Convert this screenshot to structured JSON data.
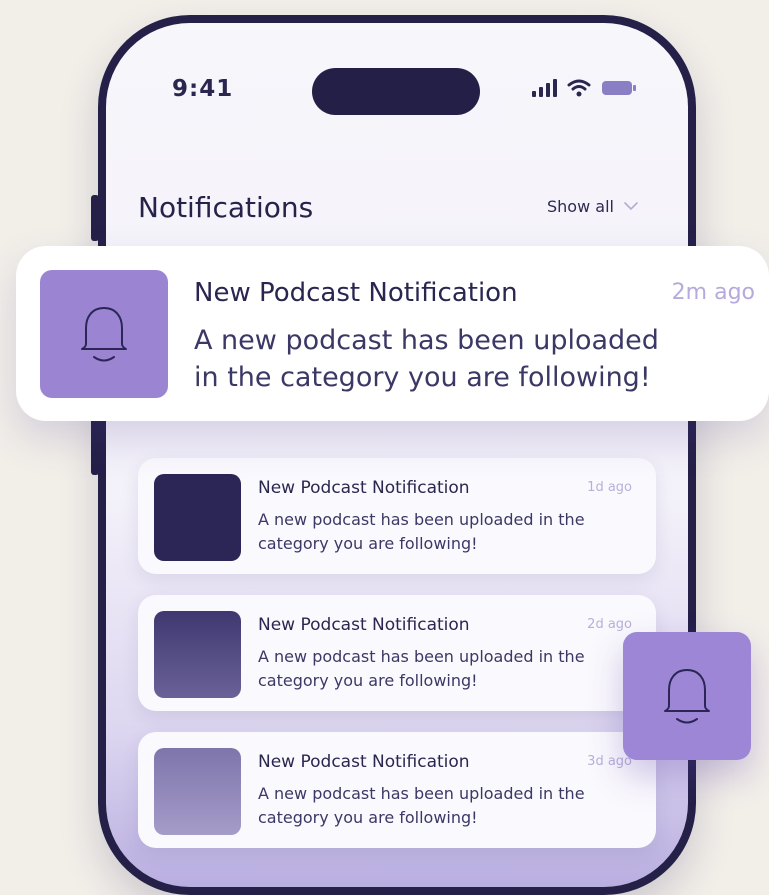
{
  "status": {
    "time": "9:41"
  },
  "header": {
    "title": "Notifications",
    "show_all_label": "Show all"
  },
  "featured": {
    "title": "New Podcast Notification",
    "time": "2m ago",
    "body": "A new podcast has been uploaded in the category you are following!",
    "icon": "bell-icon"
  },
  "notifications": [
    {
      "title": "New Podcast Notification",
      "time": "1d ago",
      "body": "A new podcast has been uploaded in the category you are following!",
      "thumb_color": "#2c2657"
    },
    {
      "title": "New Podcast Notification",
      "time": "2d ago",
      "body": "A new podcast has been uploaded in the category you are following!",
      "thumb_color": "#574d86"
    },
    {
      "title": "New Podcast Notification",
      "time": "3d ago",
      "body": "A new podcast has been uploaded in the category you are following!",
      "thumb_color": "#8e84b8"
    }
  ],
  "floating_tile": {
    "icon": "bell-icon"
  },
  "colors": {
    "accent": "#9b85d2",
    "phone_frame": "#242048",
    "background": "#f2efe9"
  }
}
